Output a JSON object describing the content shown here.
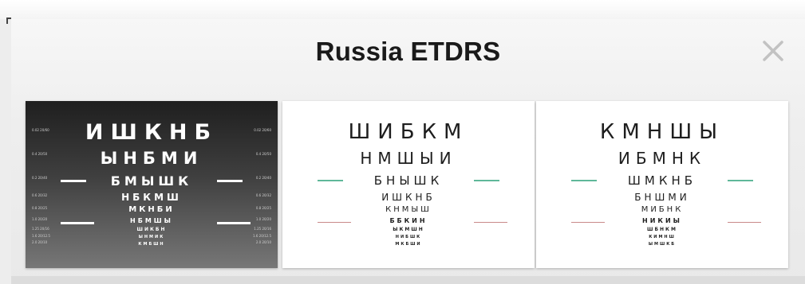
{
  "dialog": {
    "title": "Russia ETDRS",
    "close_icon": "close-x-icon"
  },
  "colors": {
    "dark_chart_top": "#1f1f1f",
    "dark_chart_bottom": "#777777",
    "light_chart_bg": "#ffffff",
    "green_line": "#5fb89a",
    "red_line": "#c98a8a"
  },
  "thumbnails": [
    {
      "variant": "dark",
      "rows": [
        "ИШКНБ",
        "ЫНБМИ",
        "БМЫШК",
        "НБКМШ",
        "МКНБИ",
        "НБМШЫ",
        "ШИКБН",
        "ЫНМИК",
        "КМБШН"
      ],
      "left_labels": [
        "0.02 20/60",
        "0.4 20/50",
        "0.2 20/40",
        "0.6 20/32",
        "0.8 20/25",
        "1.0 20/20",
        "1.25 20/16",
        "1.6 20/12.5",
        "2.0 20/10"
      ],
      "right_labels": [
        "0.02 20/60",
        "0.4 20/50",
        "0.2 20/40",
        "0.6 20/32",
        "0.8 20/25",
        "1.0 20/20",
        "1.25 20/16",
        "1.6 20/12.5",
        "2.0 20/10"
      ]
    },
    {
      "variant": "light",
      "rows": [
        "ШИБКМ",
        "НМШЫИ",
        "БНЫШК",
        "ИШКНБ",
        "КНМЫШ",
        "ББКИН",
        "ЫКМШН",
        "НИБШК",
        "МКБШИ"
      ],
      "left_labels": [
        "",
        "",
        "",
        "",
        "",
        "",
        "",
        "",
        ""
      ],
      "right_labels": [
        "",
        "",
        "",
        "",
        "",
        "",
        "",
        "",
        ""
      ]
    },
    {
      "variant": "light",
      "rows": [
        "КМНШЫ",
        "ИБМНК",
        "ШМКНБ",
        "БНШМИ",
        "МИБНК",
        "НИКИЫ",
        "ШБНКМ",
        "КИМНШ",
        "ЫМШКБ"
      ],
      "left_labels": [
        "",
        "",
        "",
        "",
        "",
        "",
        "",
        "",
        ""
      ],
      "right_labels": [
        "",
        "",
        "",
        "",
        "",
        "",
        "",
        "",
        ""
      ]
    }
  ]
}
